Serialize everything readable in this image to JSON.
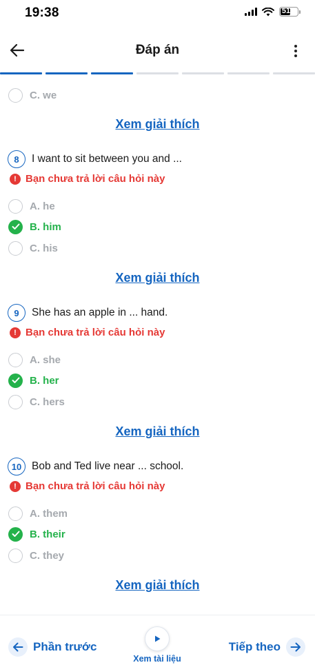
{
  "status": {
    "time": "19:38",
    "battery": "51"
  },
  "header": {
    "title": "Đáp án"
  },
  "progress": {
    "segments": 7,
    "completed_segments": [
      1,
      3
    ]
  },
  "top_option": {
    "label": "C. we"
  },
  "explain_label": "Xem giải thích",
  "unanswered_text": "Bạn chưa trả lời câu hỏi này",
  "questions": [
    {
      "number": "8",
      "text": "I want to sit between you and ...",
      "options": [
        {
          "label": "A. he",
          "correct": false
        },
        {
          "label": "B. him",
          "correct": true
        },
        {
          "label": "C. his",
          "correct": false
        }
      ]
    },
    {
      "number": "9",
      "text": "She has an apple in ... hand.",
      "options": [
        {
          "label": "A. she",
          "correct": false
        },
        {
          "label": "B. her",
          "correct": true
        },
        {
          "label": "C. hers",
          "correct": false
        }
      ]
    },
    {
      "number": "10",
      "text": "Bob and Ted live near ... school.",
      "options": [
        {
          "label": "A. them",
          "correct": false
        },
        {
          "label": "B. their",
          "correct": true
        },
        {
          "label": "C. they",
          "correct": false
        }
      ]
    }
  ],
  "bottom": {
    "prev_label": "Phần trước",
    "doc_label": "Xem tài liệu",
    "next_label": "Tiếp theo"
  },
  "colors": {
    "accent": "#1565c0",
    "correct": "#24b24b",
    "error": "#e53935",
    "muted": "#a5a9ae"
  }
}
